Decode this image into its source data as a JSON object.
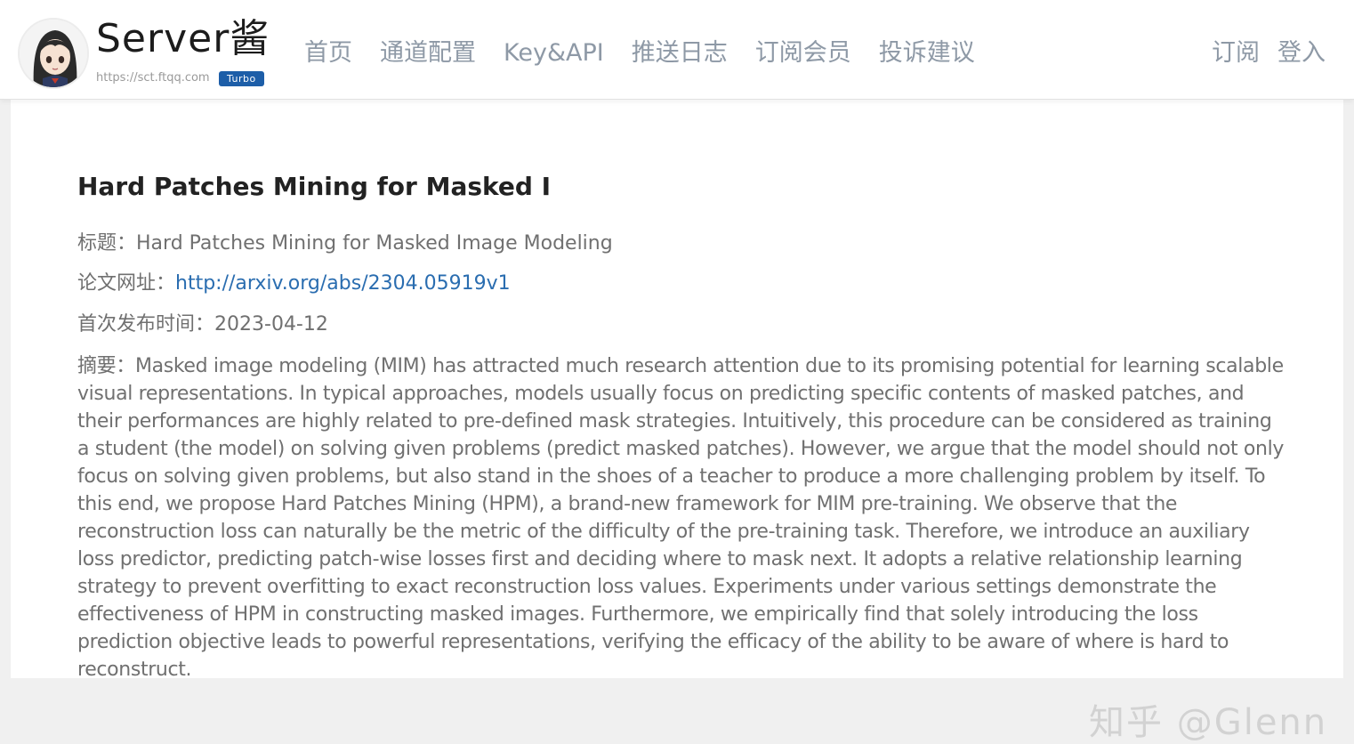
{
  "header": {
    "brand_name": "Server酱",
    "brand_url": "https://sct.ftqq.com",
    "badge": "Turbo",
    "nav": [
      "首页",
      "通道配置",
      "Key&API",
      "推送日志",
      "订阅会员",
      "投诉建议"
    ],
    "right_links": [
      "订阅",
      "登入"
    ]
  },
  "post": {
    "title": "Hard Patches Mining for Masked I",
    "fields": {
      "title_label": "标题：",
      "title_value": "Hard Patches Mining for Masked Image Modeling",
      "url_label": "论文网址：",
      "url_value": "http://arxiv.org/abs/2304.05919v1",
      "date_label": "首次发布时间：",
      "date_value": "2023-04-12",
      "abstract_label": "摘要：",
      "abstract_value": "Masked image modeling (MIM) has attracted much research attention due to its promising potential for learning scalable visual representations. In typical approaches, models usually focus on predicting specific contents of masked patches, and their performances are highly related to pre-defined mask strategies. Intuitively, this procedure can be considered as training a student (the model) on solving given problems (predict masked patches). However, we argue that the model should not only focus on solving given problems, but also stand in the shoes of a teacher to produce a more challenging problem by itself. To this end, we propose Hard Patches Mining (HPM), a brand-new framework for MIM pre-training. We observe that the reconstruction loss can naturally be the metric of the difficulty of the pre-training task. Therefore, we introduce an auxiliary loss predictor, predicting patch-wise losses first and deciding where to mask next. It adopts a relative relationship learning strategy to prevent overfitting to exact reconstruction loss values. Experiments under various settings demonstrate the effectiveness of HPM in constructing masked images. Furthermore, we empirically find that solely introducing the loss prediction objective leads to powerful representations, verifying the efficacy of the ability to be aware of where is hard to reconstruct."
    }
  },
  "watermark": "知乎 @Glenn",
  "colors": {
    "badge_bg": "#1d5ea8",
    "link": "#2a6db0",
    "nav_text": "#8e99a6"
  },
  "icons": {
    "avatar": "anime-girl-avatar"
  }
}
